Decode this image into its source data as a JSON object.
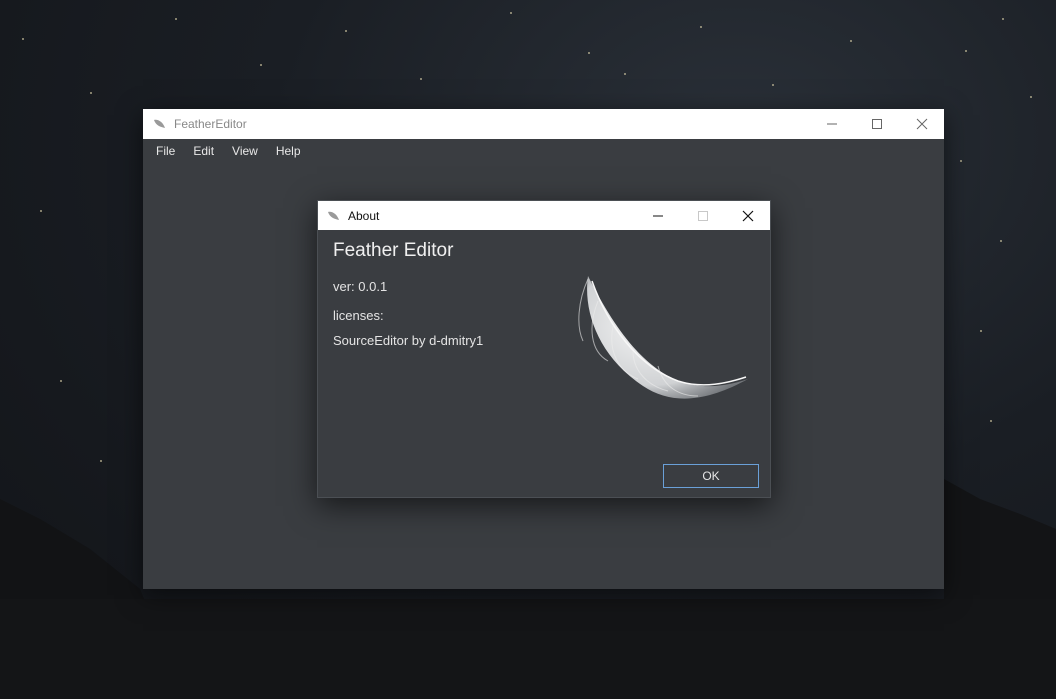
{
  "main_window": {
    "title": "FeatherEditor",
    "menu": [
      "File",
      "Edit",
      "View",
      "Help"
    ]
  },
  "dialog": {
    "title": "About",
    "heading": "Feather Editor",
    "version": "ver: 0.0.1",
    "licenses_label": "licenses:",
    "license_entry": "SourceEditor by d-dmitry1",
    "ok_label": "OK"
  },
  "icons": {
    "app": "feather-icon",
    "minimize": "minimize-icon",
    "maximize": "maximize-icon",
    "close": "close-icon",
    "about_logo": "feather-logo"
  },
  "colors": {
    "window_bg": "#3a3d41",
    "titlebar_bg": "#ffffff",
    "accent": "#6aa0d8"
  }
}
